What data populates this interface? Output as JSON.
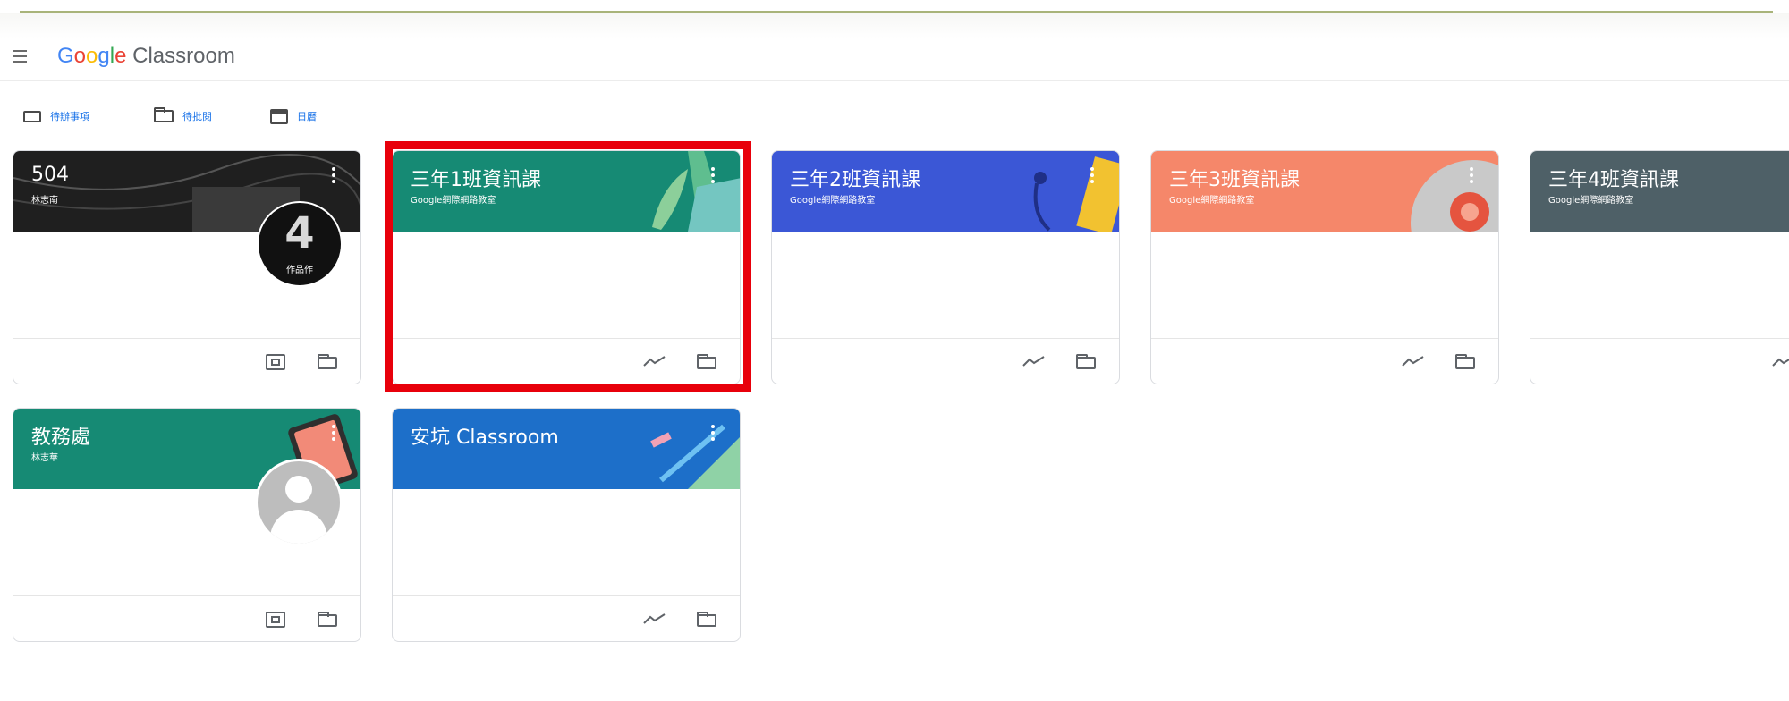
{
  "app": {
    "brand_google": "Google",
    "brand_product": "Classroom"
  },
  "nav_links": [
    {
      "label": "待辦事項",
      "icon": "assignment-icon"
    },
    {
      "label": "待批閱",
      "icon": "folder-icon"
    },
    {
      "label": "日曆",
      "icon": "calendar-icon"
    }
  ],
  "cards": [
    {
      "title": "504",
      "subtitle": "林志南",
      "color": "#1f1f1f",
      "footer_icons": [
        "photo-icon",
        "folder-icon"
      ]
    },
    {
      "title": "三年1班資訊課",
      "subtitle": "Google網際網路教室",
      "color": "#168a74",
      "footer_icons": [
        "trend-icon",
        "folder-icon"
      ]
    },
    {
      "title": "三年2班資訊課",
      "subtitle": "Google網際網路教室",
      "color": "#3b57d6",
      "footer_icons": [
        "trend-icon",
        "folder-icon"
      ]
    },
    {
      "title": "三年3班資訊課",
      "subtitle": "Google網際網路教室",
      "color": "#f5876a",
      "footer_icons": [
        "trend-icon",
        "folder-icon"
      ]
    },
    {
      "title": "三年4班資訊課",
      "subtitle": "Google網際網路教室",
      "color": "#4e6067",
      "footer_icons": [
        "trend-icon"
      ]
    },
    {
      "title": "教務處",
      "subtitle": "林志華",
      "color": "#168a74",
      "footer_icons": [
        "photo-icon",
        "folder-icon"
      ]
    },
    {
      "title": "安坑 Classroom",
      "subtitle": "",
      "color": "#1d6fc9",
      "footer_icons": [
        "trend-icon",
        "folder-icon"
      ]
    }
  ],
  "avatar_504_text": "4",
  "avatar_504_caption": "作品作",
  "highlight_color": "#e8000b"
}
